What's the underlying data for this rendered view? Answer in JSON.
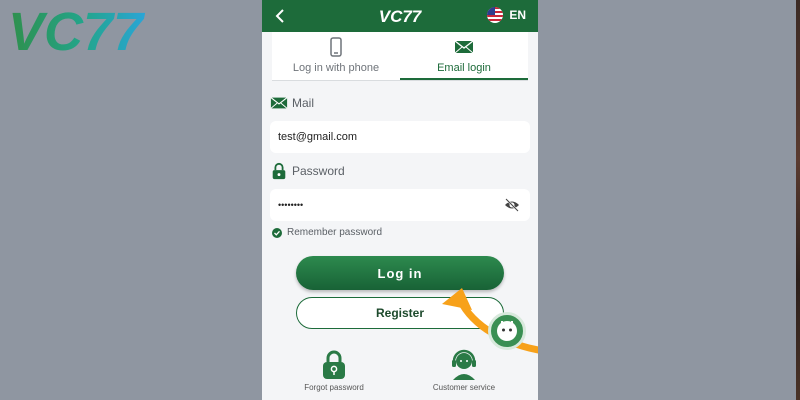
{
  "brand": {
    "logo_text": "VC77"
  },
  "topbar": {
    "logo_text": "VC77",
    "language": "EN"
  },
  "tabs": [
    {
      "label": "Log in with phone",
      "icon": "phone-icon",
      "active": false
    },
    {
      "label": "Email login",
      "icon": "mail-icon",
      "active": true
    }
  ],
  "form": {
    "mail_label": "Mail",
    "mail_value": "test@gmail.com",
    "password_label": "Password",
    "password_value": "••••••••",
    "remember_label": "Remember password"
  },
  "buttons": {
    "login": "Log in",
    "register": "Register"
  },
  "bottom": {
    "forgot_password": "Forgot password",
    "customer_service": "Customer service"
  },
  "colors": {
    "primary": "#1d6b3a",
    "accent_arrow": "#f7a11a",
    "background": "#8f96a1"
  }
}
